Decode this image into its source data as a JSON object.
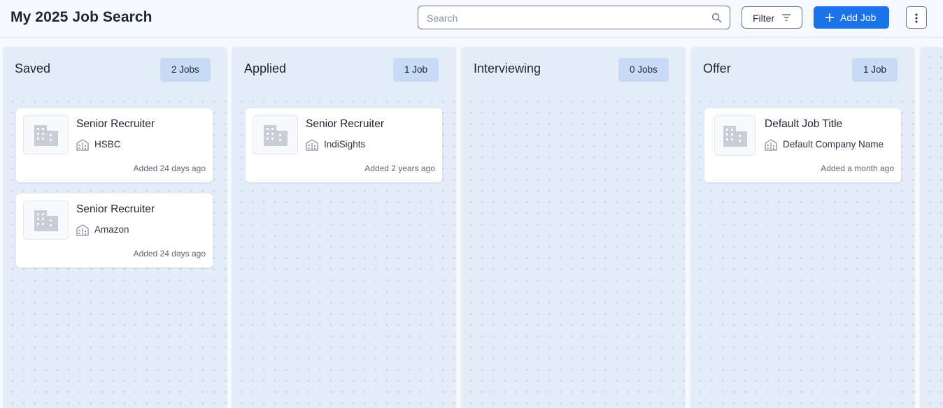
{
  "header": {
    "title": "My 2025 Job Search",
    "search_placeholder": "Search",
    "filter_label": "Filter",
    "add_job_label": "Add Job"
  },
  "columns": [
    {
      "title": "Saved",
      "count": "2 Jobs",
      "cards": [
        {
          "title": "Senior Recruiter",
          "company": "HSBC",
          "added": "Added 24 days ago"
        },
        {
          "title": "Senior Recruiter",
          "company": "Amazon",
          "added": "Added 24 days ago"
        }
      ]
    },
    {
      "title": "Applied",
      "count": "1 Job",
      "cards": [
        {
          "title": "Senior Recruiter",
          "company": "IndiSights",
          "added": "Added 2 years ago"
        }
      ]
    },
    {
      "title": "Interviewing",
      "count": "0 Jobs",
      "cards": []
    },
    {
      "title": "Offer",
      "count": "1 Job",
      "cards": [
        {
          "title": "Default Job Title",
          "company": "Default Company Name",
          "added": "Added a month ago"
        }
      ]
    }
  ],
  "icons": {
    "search": "search-icon",
    "filter": "filter-lines-icon",
    "add": "plus-icon",
    "more": "vertical-dots-icon",
    "company_logo": "building-icon",
    "company": "company-buildings-icon"
  },
  "colors": {
    "accent": "#1a73e8",
    "column_bg": "#e4ecf8",
    "count_badge": "#c8dbf6"
  }
}
